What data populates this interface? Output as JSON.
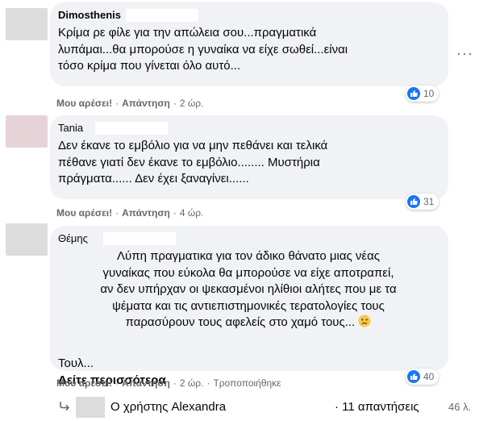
{
  "comments": [
    {
      "author": "Dimosthenis",
      "text": "Κρίμα ρε φίλε για την απώλεια σου...πραγματικά\nλυπάμαι...θα μπορούσε η γυναίκα να είχε σωθεί...είναι\nτόσο κρίμα που γίνεται όλο αυτό...",
      "like": "Μου αρέσει!",
      "reply": "Απάντηση",
      "time": "2 ώρ.",
      "reactions": "10",
      "reaction_icon": "like-icon"
    },
    {
      "author": "Tania",
      "text": "Δεν έκανε το εμβόλιο για να μην πεθάνει και τελικά\nπέθανε γιατί δεν έκανε το εμβόλιο........ Μυστήρια\nπράγματα...... Δεν έχει ξαναγίνει......",
      "like": "Μου αρέσει!",
      "reply": "Απάντηση",
      "time": "4 ώρ.",
      "reactions": "31",
      "reaction_icon": "like-icon"
    },
    {
      "author": "Θέμης",
      "text": "Λύπη πραγματικα για τον άδικο θάνατο μιας νέας\nγυναίκας που εύκολα θα μπορούσε να είχε αποτραπεί,\nαν δεν υπήρχαν οι ψεκασμένοι ηλίθιοι αλήτες που με τα\nψέματα και τις αντιεπιστημονικές τερατολογίες τους\nπαρασύρουν τους αφελείς στο χαμό τους...",
      "truncated": "Τουλ...",
      "see_more": "Δείτε περισσότερα",
      "like": "Μου αρέσει!",
      "reply": "Απάντηση",
      "time": "2 ώρ.",
      "edited": "Τροποποιήθηκε",
      "reactions": "40",
      "reaction_icon": "like-icon"
    }
  ],
  "reply_summary": {
    "user": "Ο χρήστης Alexandra",
    "count": "· 11 απαντήσεις",
    "time": "46 λ."
  },
  "colors": {
    "bubble": "#f0f2f5",
    "meta": "#65676b",
    "like_blue": "#1877f2"
  }
}
